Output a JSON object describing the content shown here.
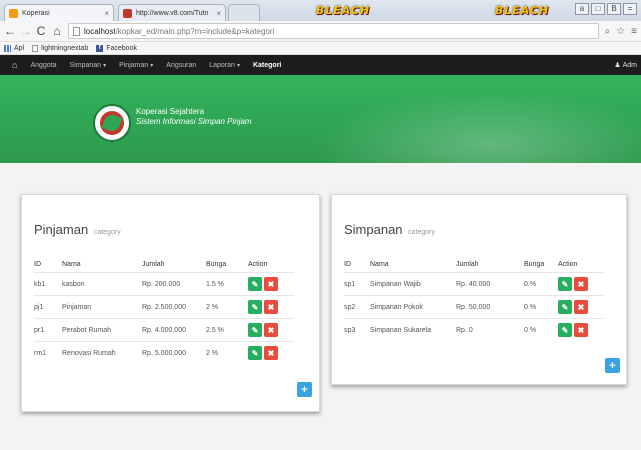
{
  "browser": {
    "tabs": [
      {
        "title": "Koperasi",
        "close": "×"
      },
      {
        "title": "http://www.v8.com/Tutn",
        "close": "×"
      },
      {
        "title": ""
      }
    ],
    "banner_text": "BLEACH",
    "window_controls": [
      "a",
      "□",
      "B",
      "="
    ],
    "url_host": "localhost",
    "url_path": "/kopkar_ed/main.php?m=include&p=kategori",
    "bookmarks": [
      "Apl",
      "lightningnextab",
      "Facebook"
    ]
  },
  "navbar": {
    "items": [
      {
        "label": "Anggota",
        "dropdown": false
      },
      {
        "label": "Simpanan",
        "dropdown": true
      },
      {
        "label": "Pinjaman",
        "dropdown": true
      },
      {
        "label": "Angsuran",
        "dropdown": false
      },
      {
        "label": "Laporan",
        "dropdown": true
      },
      {
        "label": "Kategori",
        "dropdown": false,
        "active": true
      }
    ],
    "user_label": "Adm"
  },
  "header": {
    "title": "Koperasi Sejahtera",
    "subtitle": "Sistem Informasi Simpan Pinjam"
  },
  "pinjaman": {
    "title": "Pinjaman",
    "subtitle": "category",
    "columns": [
      "ID",
      "Nama",
      "Jumlah",
      "Bunga",
      "Action"
    ],
    "rows": [
      {
        "id": "kb1",
        "nama": "kasbon",
        "jumlah": "Rp. 200.000",
        "bunga": "1.5 %"
      },
      {
        "id": "pj1",
        "nama": "Pinjaman",
        "jumlah": "Rp. 2.500.000",
        "bunga": "2 %"
      },
      {
        "id": "pr1",
        "nama": "Perabot Rumah",
        "jumlah": "Rp. 4.000.000",
        "bunga": "2.5 %"
      },
      {
        "id": "rm1",
        "nama": "Renovasi Rumah",
        "jumlah": "Rp. 5.000.000",
        "bunga": "2 %"
      }
    ]
  },
  "simpanan": {
    "title": "Simpanan",
    "subtitle": "category",
    "columns": [
      "ID",
      "Nama",
      "Jumlah",
      "Bunga",
      "Action"
    ],
    "rows": [
      {
        "id": "sp1",
        "nama": "Simpanan Wajib",
        "jumlah": "Rp. 40.000",
        "bunga": "0 %"
      },
      {
        "id": "sp2",
        "nama": "Simpanan Pokok",
        "jumlah": "Rp. 50.000",
        "bunga": "0 %"
      },
      {
        "id": "sp3",
        "nama": "Simpanan Sukarela",
        "jumlah": "Rp. 0",
        "bunga": "0 %"
      }
    ]
  },
  "icons": {
    "edit": "pencil-icon",
    "delete": "close-icon",
    "add": "plus-icon"
  },
  "colors": {
    "navbar": "#1d1d1d",
    "header_green": "#2ea554",
    "edit_button": "#27ae60",
    "delete_button": "#e74c3c",
    "add_button": "#3aa3e3"
  }
}
